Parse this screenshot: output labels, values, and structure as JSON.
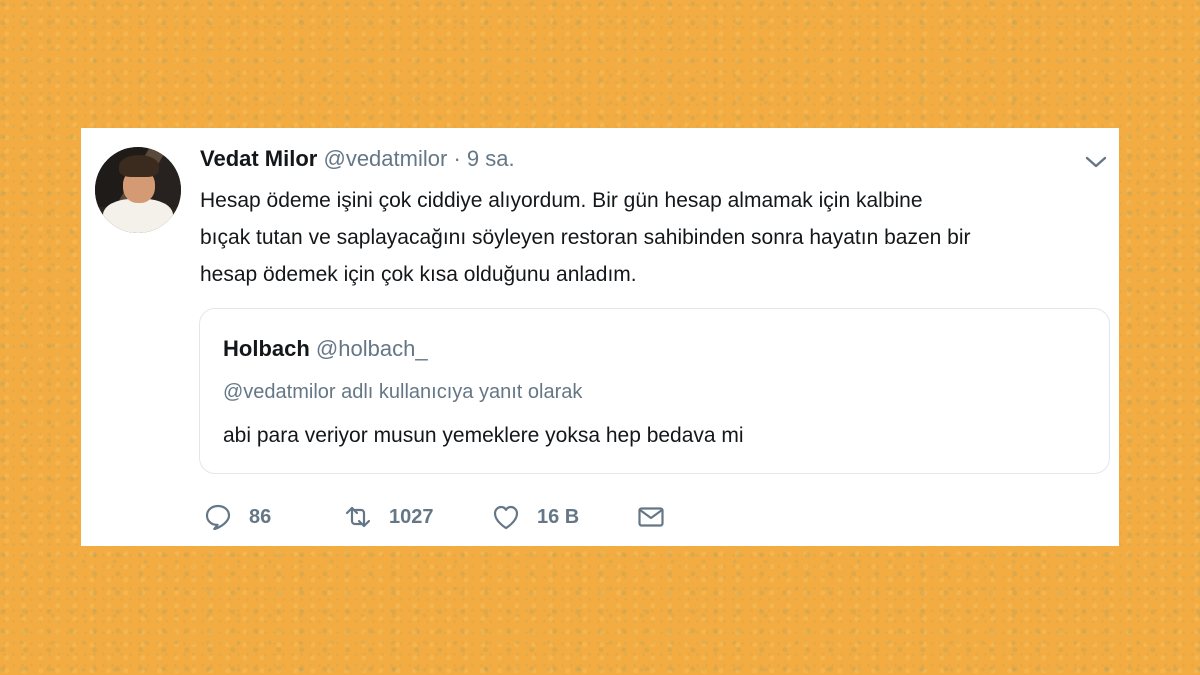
{
  "tweet": {
    "author_name": "Vedat Milor",
    "author_handle": "@vedatmilor",
    "separator": "·",
    "time": "9 sa.",
    "text_lines": [
      "Hesap ödeme işini çok ciddiye alıyordum. Bir gün hesap almamak için kalbine",
      "bıçak tutan ve saplayacağını söyleyen restoran sahibinden sonra hayatın bazen bir",
      "hesap ödemek için çok kısa olduğunu anladım."
    ],
    "quote": {
      "author_name": "Holbach",
      "author_handle": "@holbach_",
      "reply_context": "@vedatmilor adlı kullanıcıya yanıt olarak",
      "text": "abi para veriyor musun yemeklere yoksa hep bedava mi"
    },
    "actions": {
      "reply_count": "86",
      "retweet_count": "1027",
      "like_count": "16 B"
    },
    "icons": {
      "reply": "reply-icon",
      "retweet": "retweet-icon",
      "like": "heart-icon",
      "dm": "envelope-icon",
      "menu": "chevron-down-icon"
    },
    "colors": {
      "background": "#f2ac41",
      "card": "#ffffff",
      "text": "#14171a",
      "muted": "#657786",
      "border": "#e1e8ed"
    }
  }
}
